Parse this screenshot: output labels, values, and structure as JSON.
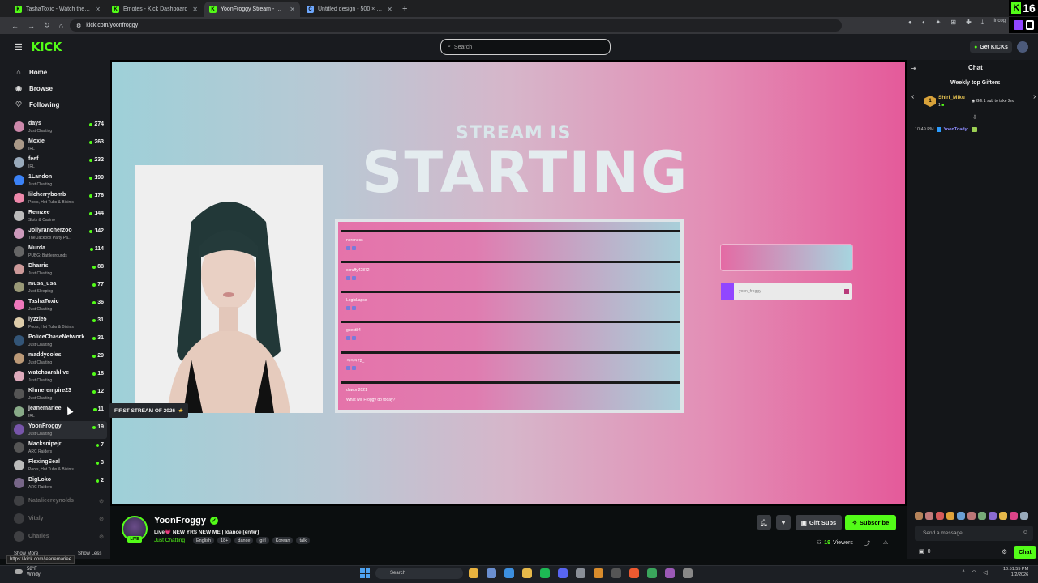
{
  "browser": {
    "tabs": [
      {
        "title": "TashaToxic - Watch the VOD o",
        "fav_color": "#53fc18",
        "fav_glyph": "K"
      },
      {
        "title": "Emotes - Kick Dashboard",
        "fav_color": "#53fc18",
        "fav_glyph": "K"
      },
      {
        "title": "YoonFroggy Stream - Watch Li",
        "fav_color": "#53fc18",
        "fav_glyph": "K"
      },
      {
        "title": "Untitled design - 500 × 500px",
        "fav_color": "#6ea8fe",
        "fav_glyph": "C"
      }
    ],
    "url": "kick.com/yoonfroggy",
    "incognito_label": "Incog",
    "corner_badge_number": "16"
  },
  "header": {
    "logo": "KICK",
    "search_placeholder": "Search",
    "get_kicks_label": "Get KICKs"
  },
  "sidebar": {
    "nav": [
      {
        "label": "Home",
        "icon": "home-icon",
        "glyph": "⌂"
      },
      {
        "label": "Browse",
        "icon": "browse-icon",
        "glyph": "◉"
      },
      {
        "label": "Following",
        "icon": "heart-icon",
        "glyph": "♡"
      }
    ],
    "following": [
      {
        "name": "days",
        "category": "Just Chatting",
        "viewers": "274",
        "color": "#c8a"
      },
      {
        "name": "Moxie",
        "category": "IRL",
        "viewers": "263",
        "color": "#a98"
      },
      {
        "name": "feef",
        "category": "IRL",
        "viewers": "232",
        "color": "#9ab"
      },
      {
        "name": "1Landon",
        "category": "Just Chatting",
        "viewers": "199",
        "color": "#3b82f6"
      },
      {
        "name": "lilcherrybomb",
        "category": "Pools, Hot Tubs & Bikinis",
        "viewers": "176",
        "color": "#e8a"
      },
      {
        "name": "Remzee",
        "category": "Slots & Casino",
        "viewers": "144",
        "color": "#bbb"
      },
      {
        "name": "Jollyrancherzoo",
        "category": "The Jackbox Party Pa...",
        "viewers": "142",
        "color": "#c9b"
      },
      {
        "name": "Murda",
        "category": "PUBG: Battlegrounds",
        "viewers": "114",
        "color": "#666"
      },
      {
        "name": "Dharris",
        "category": "Just Chatting",
        "viewers": "88",
        "color": "#c99"
      },
      {
        "name": "musa_usa",
        "category": "Just Sleeping",
        "viewers": "77",
        "color": "#997"
      },
      {
        "name": "TashaToxic",
        "category": "Just Chatting",
        "viewers": "36",
        "color": "#e7b"
      },
      {
        "name": "lyzzie5",
        "category": "Pools, Hot Tubs & Bikinis",
        "viewers": "31",
        "color": "#dca"
      },
      {
        "name": "PoliceChaseNetwork",
        "category": "Just Chatting",
        "viewers": "31",
        "color": "#357"
      },
      {
        "name": "maddycoles",
        "category": "Just Chatting",
        "viewers": "29",
        "color": "#b97"
      },
      {
        "name": "watchsarahlive",
        "category": "Just Chatting",
        "viewers": "18",
        "color": "#dab"
      },
      {
        "name": "Khmerempire23",
        "category": "Just Chatting",
        "viewers": "12",
        "color": "#555"
      },
      {
        "name": "jeanemariee",
        "category": "IRL",
        "viewers": "11",
        "color": "#8a8"
      },
      {
        "name": "YoonFroggy",
        "category": "Just Chatting",
        "viewers": "19",
        "color": "#75a"
      },
      {
        "name": "Macksnipejr",
        "category": "ARC Raiders",
        "viewers": "7",
        "color": "#555"
      },
      {
        "name": "FlexingSeal",
        "category": "Pools, Hot Tubs & Bikinis",
        "viewers": "3",
        "color": "#bbb"
      },
      {
        "name": "BigLoko",
        "category": "ARC Raiders",
        "viewers": "2",
        "color": "#768"
      }
    ],
    "offline": [
      {
        "name": "Natalieereynolds",
        "color": "#888"
      },
      {
        "name": "Vitaly",
        "color": "#777"
      },
      {
        "name": "Charles",
        "color": "#888"
      }
    ],
    "show_more": "Show More",
    "show_less": "Show Less",
    "status_url": "https://kick.com/jeanemariee",
    "tooltip": "FIRST STREAM OF 2026"
  },
  "stream_overlay": {
    "line1": "STREAM IS",
    "line2": "STARTING",
    "chat_rows": [
      "nerdness",
      "scruffy42872",
      "LogicLapse",
      "guest84",
      "ㅋㅋㅋ72_",
      "dawon2021"
    ],
    "last_message": "What will Froggy do today?",
    "username_tag": "yoon_froggy"
  },
  "chat": {
    "title": "Chat",
    "gifters_heading": "Weekly top Gifters",
    "top_gifter_name": "Shiri_Miku",
    "top_gifter_count": "1",
    "gifter_rank": "1",
    "gift_tip": "Gift 1 sub to take 2nd",
    "message_time": "10:49 PM",
    "message_user": "YoonToady:",
    "input_placeholder": "Send a message",
    "kicks_count": "0",
    "send_label": "Chat"
  },
  "stream_info": {
    "streamer": "YoonFroggy",
    "live_label": "LIVE",
    "title": "Live💗 NEW YRS NEW ME | Idance [en/kr]",
    "category": "Just Chatting",
    "tags": [
      "English",
      "18+",
      "dance",
      "girl",
      "Korean",
      "talk"
    ],
    "gift_subs_label": "Gift Subs",
    "subscribe_label": "Subscribe",
    "viewers_count": "19",
    "viewers_label": "Viewers"
  },
  "taskbar": {
    "temp": "58°F",
    "weather": "Windy",
    "search_placeholder": "Search",
    "time": "10:51:55 PM",
    "date": "1/2/2026"
  }
}
